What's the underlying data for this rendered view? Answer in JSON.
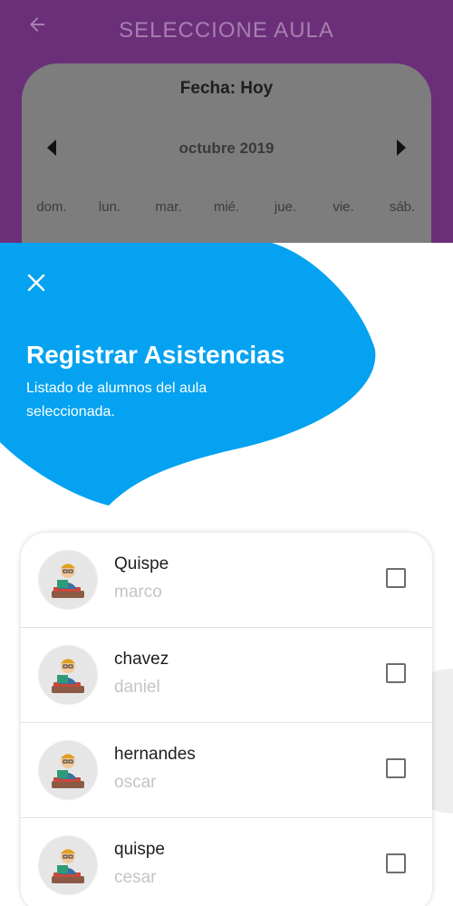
{
  "background": {
    "title": "SELECCIONE AULA",
    "date_label": "Fecha: Hoy",
    "month_label": "octubre 2019",
    "weekdays": [
      "dom.",
      "lun.",
      "mar.",
      "mié.",
      "jue.",
      "vie.",
      "sáb."
    ],
    "icons": {
      "back": "arrow-left-icon",
      "prev": "chevron-left-icon",
      "next": "chevron-right-icon"
    }
  },
  "sheet": {
    "title": "Registrar Asistencias",
    "subtitle": "Listado de alumnos del aula seleccionada.",
    "close_icon": "close-icon",
    "accent_color": "#04a2f0"
  },
  "students": [
    {
      "last_name": "Quispe",
      "first_name": "marco",
      "checked": false
    },
    {
      "last_name": "chavez",
      "first_name": "daniel",
      "checked": false
    },
    {
      "last_name": "hernandes",
      "first_name": "oscar",
      "checked": false
    },
    {
      "last_name": "quispe",
      "first_name": "cesar",
      "checked": false
    }
  ]
}
